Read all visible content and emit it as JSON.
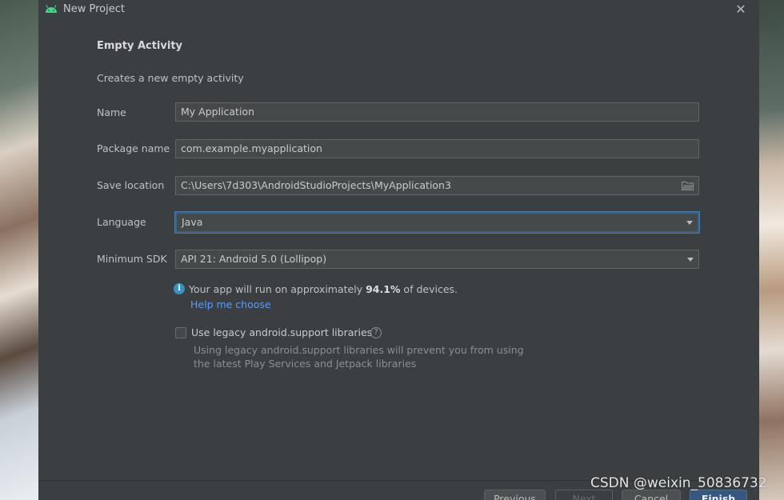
{
  "window": {
    "title": "New Project",
    "close_glyph": "✕",
    "icon": "android-icon"
  },
  "template": {
    "heading": "Empty Activity",
    "description": "Creates a new empty activity"
  },
  "form": {
    "name": {
      "label": "Name",
      "value": "My Application"
    },
    "package_name": {
      "label": "Package name",
      "value": "com.example.myapplication"
    },
    "save_location": {
      "label": "Save location",
      "value": "C:\\Users\\7d303\\AndroidStudioProjects\\MyApplication3",
      "icon": "folder-icon"
    },
    "language": {
      "label": "Language",
      "value": "Java"
    },
    "minimum_sdk": {
      "label": "Minimum SDK",
      "value": "API 21: Android 5.0 (Lollipop)"
    }
  },
  "sdk_info": {
    "icon": "info-icon",
    "prefix": "Your app will run on approximately ",
    "percent": "94.1%",
    "suffix": " of devices.",
    "help_link": "Help me choose"
  },
  "legacy": {
    "checked": false,
    "label": "Use legacy android.support libraries",
    "help_glyph": "?",
    "description": "Using legacy android.support libraries will prevent you from using the latest Play Services and Jetpack libraries"
  },
  "buttons": {
    "previous": "Previous",
    "next": "Next",
    "cancel": "Cancel",
    "finish": "Finish"
  },
  "watermark": "CSDN @weixin_50836732",
  "colors": {
    "accent": "#365880",
    "link": "#589df6",
    "android_green": "#3ddc84",
    "info_blue": "#3592c4"
  }
}
